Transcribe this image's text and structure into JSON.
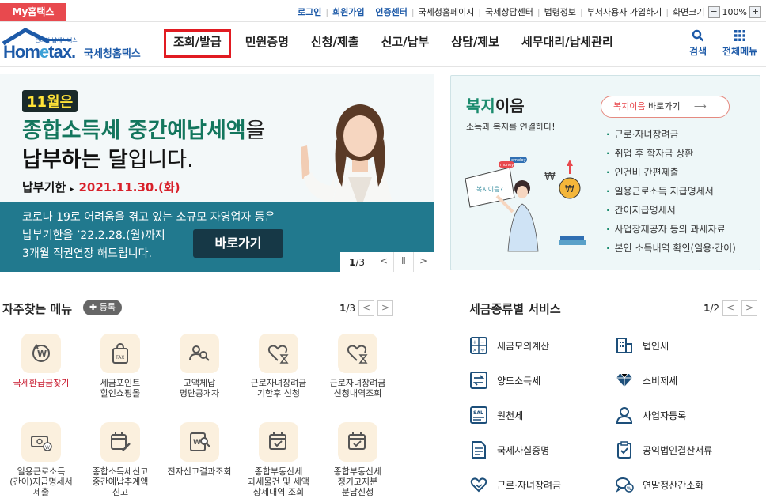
{
  "topbar": {
    "my_hometax": "My홈택스",
    "links_bold": [
      "로그인",
      "회원가입",
      "인증센터"
    ],
    "links": [
      "국세청홈페이지",
      "국세상담센터",
      "법령정보",
      "부서사용자 가입하기",
      "화면크기"
    ],
    "zoom_minus": "−",
    "zoom_level": "100%",
    "zoom_plus": "+"
  },
  "header": {
    "logo_small": "편리한 납세서비스",
    "logo_main_1": "Hom",
    "logo_main_e": "e",
    "logo_main_2": "tax.",
    "logo_kr": "국세청홈택스",
    "nav": [
      "조회/발급",
      "민원증명",
      "신청/제출",
      "신고/납부",
      "상담/제보",
      "세무대리/납세관리"
    ],
    "search_label": "검색",
    "all_menu_label": "전체메뉴"
  },
  "banner": {
    "month": "11월은",
    "line1_bold": "종합소득세 중간예납세액",
    "line1_tail": "을",
    "line2_bold": "납부하는 달",
    "line2_tail": "입니다.",
    "due_label": "납부기한",
    "due_arrow": "▸",
    "due_date": "2021.11.30.(화)",
    "notice_line1": "코로나 19로 어려움을 겪고 있는 소규모 자영업자 등은",
    "notice_line2": "납부기한을 ’22.2.28.(월)까지",
    "notice_line3": "3개월 직권연장 해드립니다.",
    "go_button": "바로가기",
    "page_current": "1",
    "page_total": "/3",
    "prev": "<",
    "pause": "Ⅱ",
    "next": ">"
  },
  "welfare": {
    "title_green": "복지",
    "title_rest": "이음",
    "subtitle": "소득과 복지를 연결하다!",
    "btn_red": "복지이음",
    "btn_rest": " 바로가기",
    "btn_arrow": "⟶",
    "items": [
      "근로·자녀장려금",
      "취업 후 학자금 상환",
      "인건비 간편제출",
      "일용근로소득 지급명세서",
      "간이지급명세서",
      "사업장제공자 등의 과세자료",
      "본인 소득내역 확인(일용·간이)"
    ],
    "illust_sign": "복지이음?",
    "illust_tag1": "employ",
    "illust_tag2": "money"
  },
  "favorites": {
    "title": "자주찾는 메뉴",
    "add_label": "✚ 등록",
    "page_current": "1",
    "page_total": "/3",
    "prev": "<",
    "next": ">",
    "items": [
      {
        "label": "국세환급금찾기",
        "icon": "refund-won-icon"
      },
      {
        "label": "세금포인트\n할인쇼핑몰",
        "icon": "tax-bag-icon"
      },
      {
        "label": "고액체납\n명단공개자",
        "icon": "people-search-icon"
      },
      {
        "label": "근로자녀장려금\n기한후 신청",
        "icon": "heart-hourglass-icon"
      },
      {
        "label": "근로자녀장려금\n신청내역조회",
        "icon": "heart-hourglass-icon"
      },
      {
        "label": "일용근로소득\n(간이)지급명세서\n제출",
        "icon": "won-money-icon"
      },
      {
        "label": "종합소득세신고\n중간예납추계액\n신고",
        "icon": "calendar-pen-icon"
      },
      {
        "label": "전자신고결과조회",
        "icon": "document-search-icon"
      },
      {
        "label": "종합부동산세\n과세물건 및 세액\n상세내역 조회",
        "icon": "calendar-check-icon"
      },
      {
        "label": "종합부동산세\n정기고지분\n분납신청",
        "icon": "calendar-check-icon"
      }
    ]
  },
  "taxsvc": {
    "title": "세금종류별 서비스",
    "page_current": "1",
    "page_total": "/2",
    "prev": "<",
    "next": ">",
    "items": [
      {
        "label": "세금모의계산",
        "icon": "calculator-icon"
      },
      {
        "label": "법인세",
        "icon": "building-icon"
      },
      {
        "label": "양도소득세",
        "icon": "transfer-money-icon"
      },
      {
        "label": "소비제세",
        "icon": "diamond-icon"
      },
      {
        "label": "원천세",
        "icon": "salary-doc-icon"
      },
      {
        "label": "사업자등록",
        "icon": "person-icon"
      },
      {
        "label": "국세사실증명",
        "icon": "document-icon"
      },
      {
        "label": "공익법인결산서류",
        "icon": "clipboard-check-icon"
      },
      {
        "label": "근로·자녀장려금",
        "icon": "heart-hand-icon"
      },
      {
        "label": "연말정산간소화",
        "icon": "chat-won-icon"
      }
    ]
  },
  "colors": {
    "brand_blue": "#1d5aa8",
    "accent_red": "#e8494e",
    "banner_green": "#13765d",
    "strip_teal": "#21798e"
  }
}
